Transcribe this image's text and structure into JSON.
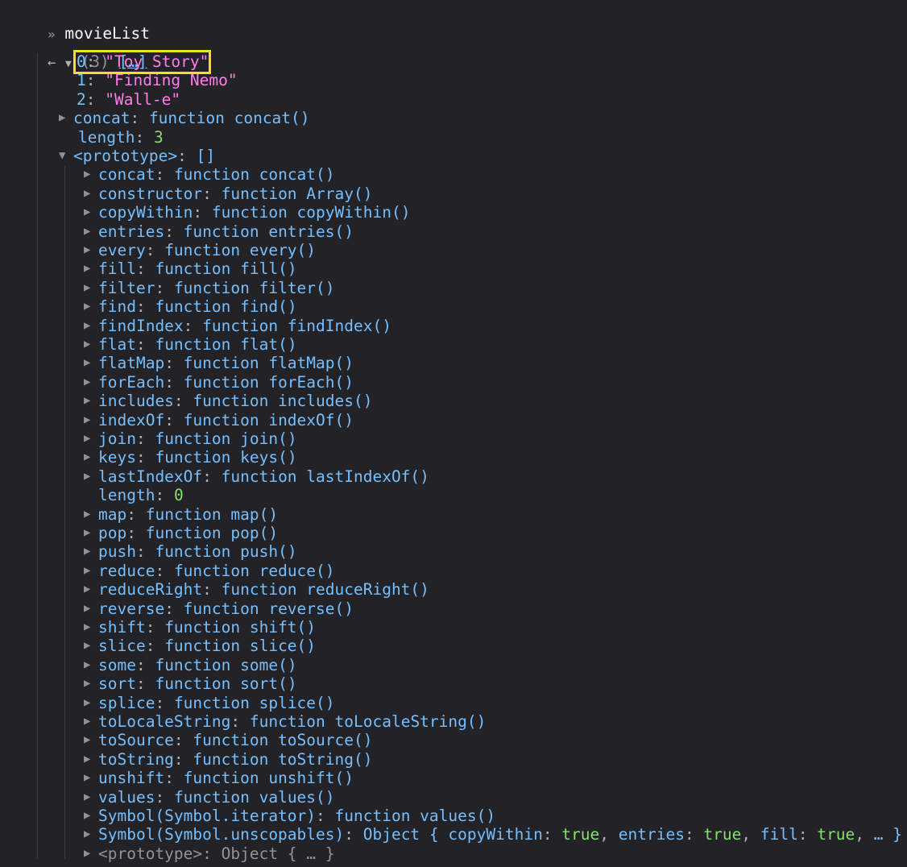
{
  "prompt": {
    "chevron": "»",
    "input": "movieList"
  },
  "result": {
    "back_arrow": "←",
    "expand_arrow": "▼",
    "count": "(3)",
    "preview": "[…]"
  },
  "items": [
    {
      "key": "0",
      "value": "\"Toy Story\""
    },
    {
      "key": "1",
      "value": "\"Finding Nemo\""
    },
    {
      "key": "2",
      "value": "\"Wall-e\""
    }
  ],
  "concat_row": {
    "key": "concat",
    "value": "function concat()"
  },
  "length_row": {
    "key": "length",
    "value": "3"
  },
  "prototype_row": {
    "key": "<prototype>",
    "value": "[]"
  },
  "proto_entries": [
    {
      "key": "concat",
      "value": "function concat()",
      "expandable": true
    },
    {
      "key": "constructor",
      "value": "function Array()",
      "expandable": true
    },
    {
      "key": "copyWithin",
      "value": "function copyWithin()",
      "expandable": true
    },
    {
      "key": "entries",
      "value": "function entries()",
      "expandable": true
    },
    {
      "key": "every",
      "value": "function every()",
      "expandable": true
    },
    {
      "key": "fill",
      "value": "function fill()",
      "expandable": true
    },
    {
      "key": "filter",
      "value": "function filter()",
      "expandable": true
    },
    {
      "key": "find",
      "value": "function find()",
      "expandable": true
    },
    {
      "key": "findIndex",
      "value": "function findIndex()",
      "expandable": true
    },
    {
      "key": "flat",
      "value": "function flat()",
      "expandable": true
    },
    {
      "key": "flatMap",
      "value": "function flatMap()",
      "expandable": true
    },
    {
      "key": "forEach",
      "value": "function forEach()",
      "expandable": true
    },
    {
      "key": "includes",
      "value": "function includes()",
      "expandable": true
    },
    {
      "key": "indexOf",
      "value": "function indexOf()",
      "expandable": true
    },
    {
      "key": "join",
      "value": "function join()",
      "expandable": true
    },
    {
      "key": "keys",
      "value": "function keys()",
      "expandable": true
    },
    {
      "key": "lastIndexOf",
      "value": "function lastIndexOf()",
      "expandable": true
    },
    {
      "key": "length",
      "value": "0",
      "expandable": false,
      "numeric": true
    },
    {
      "key": "map",
      "value": "function map()",
      "expandable": true
    },
    {
      "key": "pop",
      "value": "function pop()",
      "expandable": true
    },
    {
      "key": "push",
      "value": "function push()",
      "expandable": true
    },
    {
      "key": "reduce",
      "value": "function reduce()",
      "expandable": true
    },
    {
      "key": "reduceRight",
      "value": "function reduceRight()",
      "expandable": true
    },
    {
      "key": "reverse",
      "value": "function reverse()",
      "expandable": true
    },
    {
      "key": "shift",
      "value": "function shift()",
      "expandable": true
    },
    {
      "key": "slice",
      "value": "function slice()",
      "expandable": true
    },
    {
      "key": "some",
      "value": "function some()",
      "expandable": true
    },
    {
      "key": "sort",
      "value": "function sort()",
      "expandable": true
    },
    {
      "key": "splice",
      "value": "function splice()",
      "expandable": true
    },
    {
      "key": "toLocaleString",
      "value": "function toLocaleString()",
      "expandable": true
    },
    {
      "key": "toSource",
      "value": "function toSource()",
      "expandable": true
    },
    {
      "key": "toString",
      "value": "function toString()",
      "expandable": true
    },
    {
      "key": "unshift",
      "value": "function unshift()",
      "expandable": true
    },
    {
      "key": "values",
      "value": "function values()",
      "expandable": true
    },
    {
      "key": "Symbol(Symbol.iterator)",
      "value": "function values()",
      "expandable": true
    }
  ],
  "unscopables_row": {
    "key": "Symbol(Symbol.unscopables)",
    "prefix": "Object { ",
    "props": [
      {
        "key": "copyWithin",
        "value": "true"
      },
      {
        "key": "entries",
        "value": "true"
      },
      {
        "key": "fill",
        "value": "true"
      }
    ],
    "suffix": " … }"
  },
  "nested_proto_row": {
    "key": "<prototype>",
    "value": "Object { … }"
  },
  "colors": {
    "background": "#232327",
    "key": "#75bfff",
    "string": "#ff7de9",
    "number": "#86de74",
    "highlight_box": "#f2e11d"
  },
  "icons": {
    "expand": "triangle-right-icon",
    "collapse": "triangle-down-icon",
    "back": "back-arrow-icon",
    "prompt": "double-chevron-icon"
  }
}
